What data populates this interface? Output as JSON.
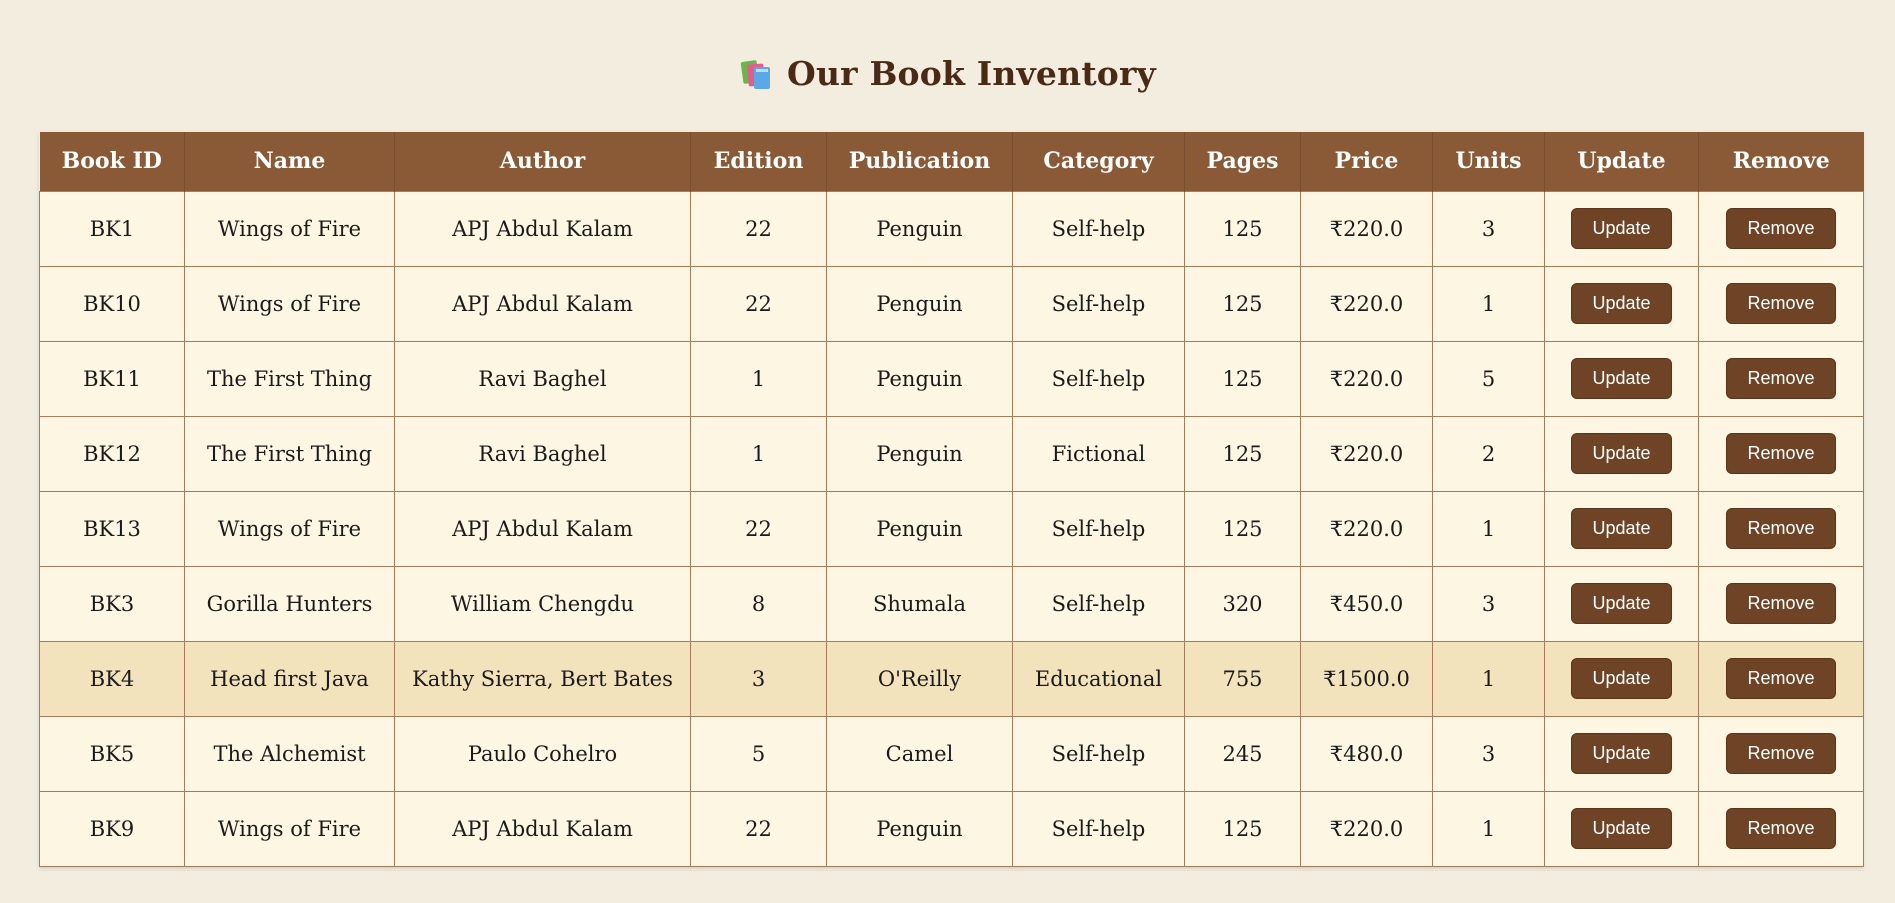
{
  "header": {
    "icon": "books-icon",
    "title": "Our Book Inventory"
  },
  "table": {
    "columns": [
      "Book ID",
      "Name",
      "Author",
      "Edition",
      "Publication",
      "Category",
      "Pages",
      "Price",
      "Units",
      "Update",
      "Remove"
    ],
    "rows": [
      {
        "id": "BK1",
        "name": "Wings of Fire",
        "author": "APJ Abdul Kalam",
        "edition": "22",
        "publication": "Penguin",
        "category": "Self-help",
        "pages": "125",
        "price": "₹220.0",
        "units": "3",
        "update_label": "Update",
        "remove_label": "Remove"
      },
      {
        "id": "BK10",
        "name": "Wings of Fire",
        "author": "APJ Abdul Kalam",
        "edition": "22",
        "publication": "Penguin",
        "category": "Self-help",
        "pages": "125",
        "price": "₹220.0",
        "units": "1",
        "update_label": "Update",
        "remove_label": "Remove"
      },
      {
        "id": "BK11",
        "name": "The First Thing",
        "author": "Ravi Baghel",
        "edition": "1",
        "publication": "Penguin",
        "category": "Self-help",
        "pages": "125",
        "price": "₹220.0",
        "units": "5",
        "update_label": "Update",
        "remove_label": "Remove"
      },
      {
        "id": "BK12",
        "name": "The First Thing",
        "author": "Ravi Baghel",
        "edition": "1",
        "publication": "Penguin",
        "category": "Fictional",
        "pages": "125",
        "price": "₹220.0",
        "units": "2",
        "update_label": "Update",
        "remove_label": "Remove"
      },
      {
        "id": "BK13",
        "name": "Wings of Fire",
        "author": "APJ Abdul Kalam",
        "edition": "22",
        "publication": "Penguin",
        "category": "Self-help",
        "pages": "125",
        "price": "₹220.0",
        "units": "1",
        "update_label": "Update",
        "remove_label": "Remove"
      },
      {
        "id": "BK3",
        "name": "Gorilla Hunters",
        "author": "William Chengdu",
        "edition": "8",
        "publication": "Shumala",
        "category": "Self-help",
        "pages": "320",
        "price": "₹450.0",
        "units": "3",
        "update_label": "Update",
        "remove_label": "Remove"
      },
      {
        "id": "BK4",
        "name": "Head first Java",
        "author": "Kathy Sierra, Bert Bates",
        "edition": "3",
        "publication": "O'Reilly",
        "category": "Educational",
        "pages": "755",
        "price": "₹1500.0",
        "units": "1",
        "update_label": "Update",
        "remove_label": "Remove"
      },
      {
        "id": "BK5",
        "name": "The Alchemist",
        "author": "Paulo Cohelro",
        "edition": "5",
        "publication": "Camel",
        "category": "Self-help",
        "pages": "245",
        "price": "₹480.0",
        "units": "3",
        "update_label": "Update",
        "remove_label": "Remove"
      },
      {
        "id": "BK9",
        "name": "Wings of Fire",
        "author": "APJ Abdul Kalam",
        "edition": "22",
        "publication": "Penguin",
        "category": "Self-help",
        "pages": "125",
        "price": "₹220.0",
        "units": "1",
        "update_label": "Update",
        "remove_label": "Remove"
      }
    ]
  },
  "colors": {
    "background": "#f2eddf",
    "header_bg": "#8a5a37",
    "row_bg": "#fdf6e3",
    "row_highlight_bg": "#f3e3bd",
    "button_bg": "#6f4426",
    "title_color": "#4a2a15"
  }
}
